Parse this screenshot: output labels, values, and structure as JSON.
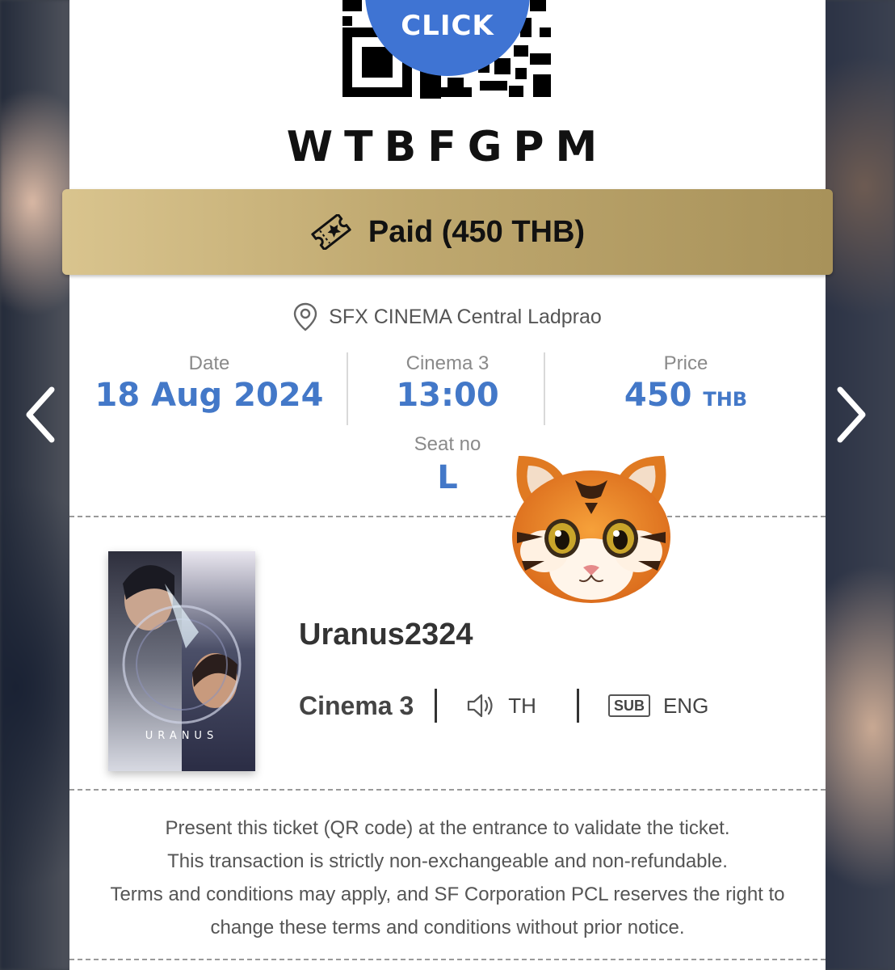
{
  "qr": {
    "click_label": "CLICK"
  },
  "booking": {
    "code": "WTBFGPM"
  },
  "payment": {
    "status_label": "Paid (450 THB)"
  },
  "venue": {
    "name": "SFX CINEMA Central Ladprao"
  },
  "details": {
    "date_label": "Date",
    "date_value": "18 Aug 2024",
    "cinema_label": "Cinema 3",
    "time_value": "13:00",
    "price_label": "Price",
    "price_value": "450",
    "price_unit": "THB",
    "seat_label": "Seat no",
    "seat_value": "L"
  },
  "movie": {
    "title": "Uranus2324",
    "cinema": "Cinema 3",
    "audio": "TH",
    "subtitle_badge": "SUB",
    "subtitle_lang": "ENG",
    "poster_text": "URANUS"
  },
  "notice": {
    "line1": "Present this ticket (QR code) at the entrance to validate the ticket.",
    "line2": "This transaction is strictly non-exchangeable and non-refundable.",
    "line3": "Terms and conditions may apply, and SF Corporation PCL reserves the right to",
    "line4": "change these terms and conditions without prior notice."
  },
  "colors": {
    "accent": "#4378c8",
    "gold": "#bfa86f",
    "badge_blue": "#3f74d3"
  }
}
